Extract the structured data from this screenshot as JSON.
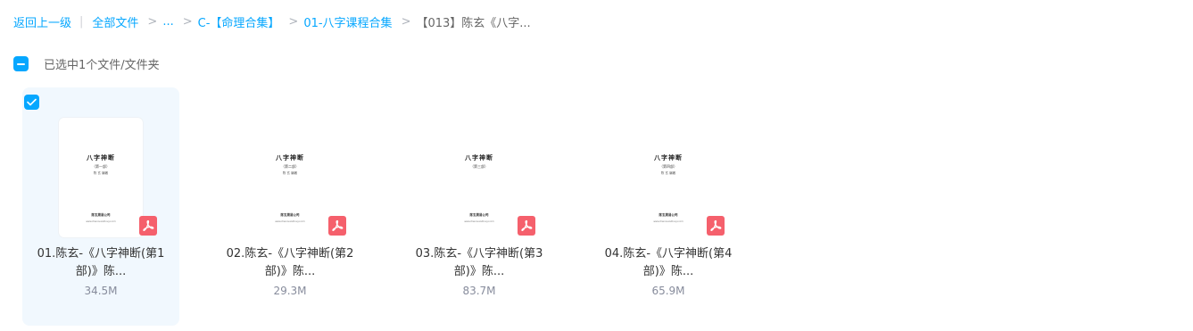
{
  "breadcrumb": {
    "back_label": "返回上一级",
    "pipe": "|",
    "root_label": "全部文件",
    "separator": ">",
    "items": [
      {
        "label": "..."
      },
      {
        "label": "C-【命理合集】"
      },
      {
        "label": "01-八字课程合集"
      }
    ],
    "current": "【013】陈玄《八字..."
  },
  "selection": {
    "status_text": "已选中1个文件/文件夹"
  },
  "files": [
    {
      "name_line1": "01.陈玄-《八字神断(第1",
      "name_line2": "部)》陈...",
      "size": "34.5M",
      "selected": true,
      "file_type": "pdf",
      "thumbnail": {
        "title": "八字神断",
        "subtitle": "（第一部）",
        "author": "陈 玄 编著",
        "publisher": "陈玄周易公司",
        "url": "www.chenxuanzhouyi.com"
      }
    },
    {
      "name_line1": "02.陈玄-《八字神断(第2",
      "name_line2": "部)》陈...",
      "size": "29.3M",
      "selected": false,
      "file_type": "pdf",
      "thumbnail": {
        "title": "八字神断",
        "subtitle": "（第二部）",
        "author": "陈 玄 编著",
        "publisher": "陈玄周易公司",
        "url": "www.chenxuanzhouyi.com"
      }
    },
    {
      "name_line1": "03.陈玄-《八字神断(第3",
      "name_line2": "部)》陈...",
      "size": "83.7M",
      "selected": false,
      "file_type": "pdf",
      "thumbnail": {
        "title": "八字神断",
        "subtitle": "（第三部）",
        "author": "",
        "publisher": "陈玄周易公司",
        "url": "www.chenxuanzhouyi.com"
      }
    },
    {
      "name_line1": "04.陈玄-《八字神断(第4",
      "name_line2": "部)》陈...",
      "size": "65.9M",
      "selected": false,
      "file_type": "pdf",
      "thumbnail": {
        "title": "八字神断",
        "subtitle": "（第四部）",
        "author": "陈 玄 编著",
        "publisher": "陈玄周易公司",
        "url": "www.chenxuanzhouyi.com"
      }
    }
  ],
  "colors": {
    "accent": "#06a7ff",
    "selected_card_bg": "#f1f8fe",
    "pdf_icon": "#f5606c",
    "meta_text": "#878c9c"
  },
  "icons": {
    "select_all": "minus-checkbox-icon",
    "card_check": "check-icon",
    "file_type": "pdf-icon"
  }
}
